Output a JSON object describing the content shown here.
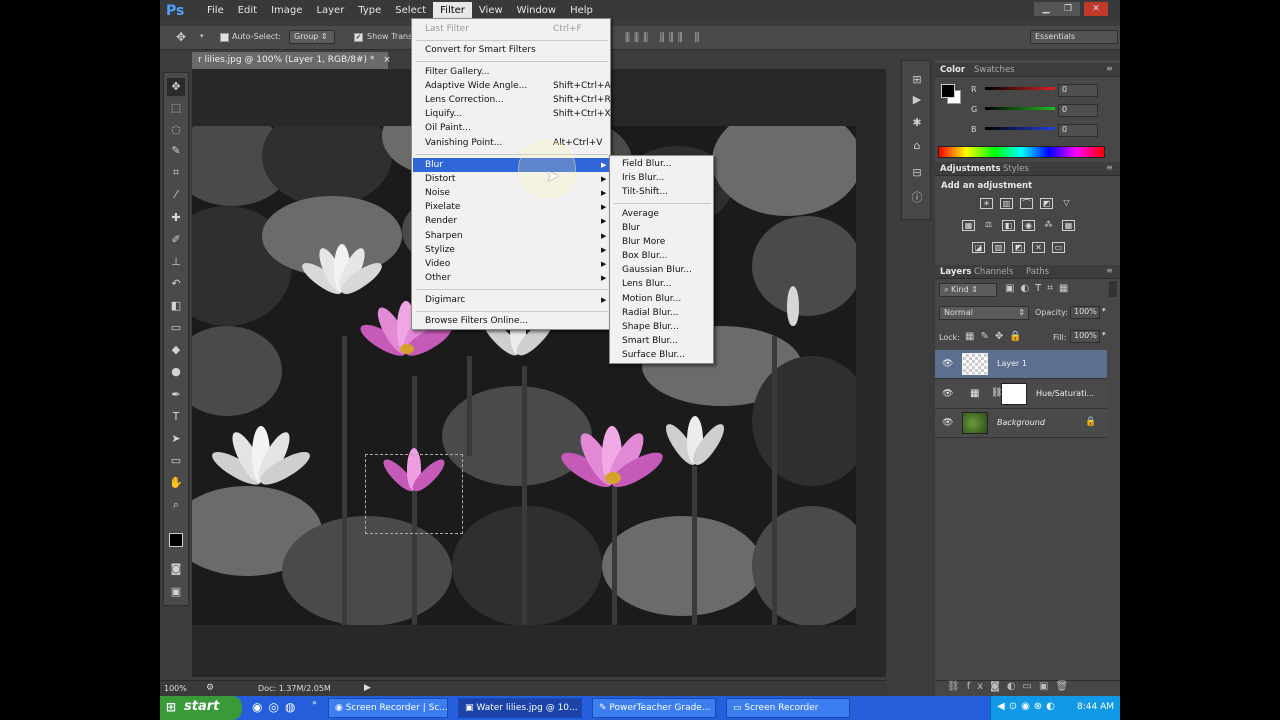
{
  "app": {
    "logo": "Ps"
  },
  "menubar": {
    "items": [
      "File",
      "Edit",
      "Image",
      "Layer",
      "Type",
      "Select",
      "Filter",
      "View",
      "Window",
      "Help"
    ],
    "active": "Filter"
  },
  "window_controls": {
    "minimize": "▁",
    "restore": "❐",
    "close": "✕"
  },
  "options_bar": {
    "auto_select_label": "Auto-Select:",
    "auto_select_target": "Group",
    "show_transform_label": "Show Trans",
    "workspace": "Essentials"
  },
  "document": {
    "tab_title": "r lilies.jpg @ 100% (Layer 1, RGB/8#) *",
    "close_glyph": "×"
  },
  "status_bar": {
    "zoom": "100%",
    "doc_info": "Doc: 1.37M/2.05M"
  },
  "filter_menu": {
    "last_filter": {
      "label": "Last Filter",
      "shortcut": "Ctrl+F"
    },
    "convert_smart": "Convert for Smart Filters",
    "gallery_items": [
      {
        "label": "Filter Gallery...",
        "shortcut": ""
      },
      {
        "label": "Adaptive Wide Angle...",
        "shortcut": "Shift+Ctrl+A"
      },
      {
        "label": "Lens Correction...",
        "shortcut": "Shift+Ctrl+R"
      },
      {
        "label": "Liquify...",
        "shortcut": "Shift+Ctrl+X"
      },
      {
        "label": "Oil Paint...",
        "shortcut": ""
      },
      {
        "label": "Vanishing Point...",
        "shortcut": "Alt+Ctrl+V"
      }
    ],
    "submenus": [
      "Blur",
      "Distort",
      "Noise",
      "Pixelate",
      "Render",
      "Sharpen",
      "Stylize",
      "Video",
      "Other"
    ],
    "highlighted": "Blur",
    "digimarc": "Digimarc",
    "browse_online": "Browse Filters Online..."
  },
  "blur_submenu": {
    "group1": [
      "Field Blur...",
      "Iris Blur...",
      "Tilt-Shift..."
    ],
    "group2": [
      "Average",
      "Blur",
      "Blur More",
      "Box Blur...",
      "Gaussian Blur...",
      "Lens Blur...",
      "Motion Blur...",
      "Radial Blur...",
      "Shape Blur...",
      "Smart Blur...",
      "Surface Blur..."
    ]
  },
  "color_panel": {
    "tabs": [
      "Color",
      "Swatches"
    ],
    "channels": [
      {
        "label": "R",
        "value": "0",
        "color": "#e02020"
      },
      {
        "label": "G",
        "value": "0",
        "color": "#20c020"
      },
      {
        "label": "B",
        "value": "0",
        "color": "#2040e0"
      }
    ]
  },
  "adjustments_panel": {
    "tabs": [
      "Adjustments",
      "Styles"
    ],
    "heading": "Add an adjustment"
  },
  "layers_panel": {
    "tabs": [
      "Layers",
      "Channels",
      "Paths"
    ],
    "filter_kind": "Kind",
    "blend_mode": "Normal",
    "opacity_label": "Opacity:",
    "opacity_value": "100%",
    "lock_label": "Lock:",
    "fill_label": "Fill:",
    "fill_value": "100%",
    "layers": [
      {
        "name": "Layer 1",
        "selected": true
      },
      {
        "name": "Hue/Saturati...",
        "selected": false
      },
      {
        "name": "Background",
        "selected": false
      }
    ]
  },
  "taskbar": {
    "start_label": "start",
    "buttons": [
      {
        "label": "Screen Recorder | Sc...",
        "active": false
      },
      {
        "label": "Water lilies.jpg @ 10...",
        "active": true
      },
      {
        "label": "PowerTeacher Grade...",
        "active": false
      },
      {
        "label": "Screen Recorder",
        "active": false
      }
    ],
    "clock": "8:44 AM"
  },
  "colors": {
    "ps_blue": "#4da0ff",
    "menu_highlight": "#3166d8",
    "xp_taskbar": "#245edb",
    "xp_start": "#3a9a3a"
  }
}
